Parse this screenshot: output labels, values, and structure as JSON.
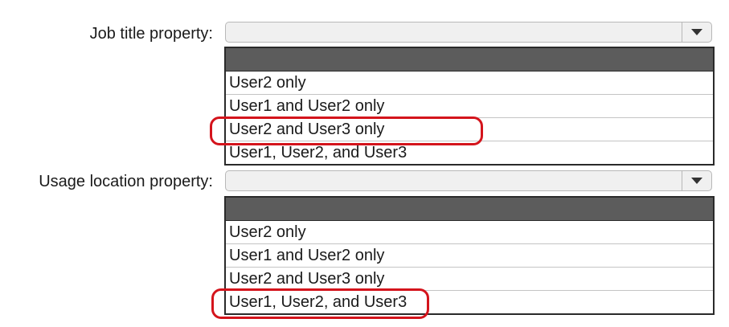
{
  "job_title": {
    "label": "Job title property:",
    "options": [
      "User2 only",
      "User1 and User2 only",
      "User2 and User3 only",
      "User1, User2, and User3"
    ],
    "selected_answer": "User2 and User3 only"
  },
  "usage_location": {
    "label": "Usage location property:",
    "options": [
      "User2 only",
      "User1 and User2 only",
      "User2 and User3 only",
      "User1, User2, and User3"
    ],
    "selected_answer": "User1, User2, and User3"
  },
  "colors": {
    "highlight": "#d4141c",
    "list_header": "#5c5c5c",
    "select_background": "#f0f0f0"
  },
  "icons": {
    "dropdown": "chevron-down-icon"
  }
}
